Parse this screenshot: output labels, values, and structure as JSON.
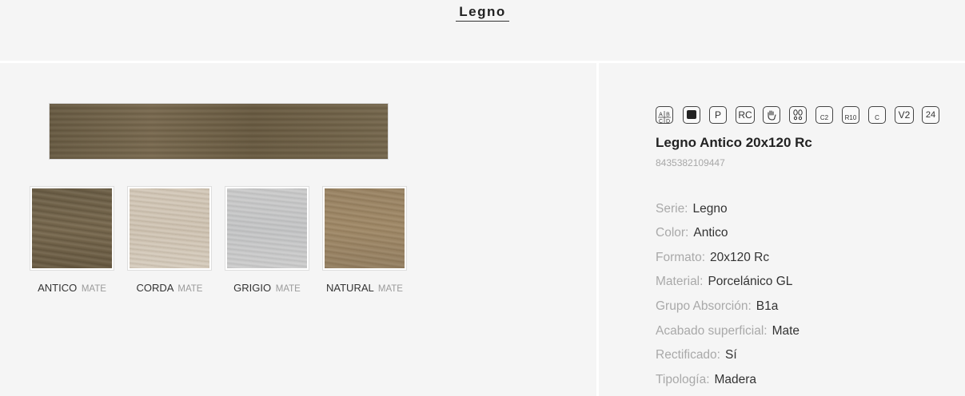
{
  "collection_title": "Legno",
  "product": {
    "name": "Legno Antico 20x120 Rc",
    "ean": "8435382109447"
  },
  "variants": [
    {
      "name": "ANTICO",
      "finish": "MATE"
    },
    {
      "name": "CORDA",
      "finish": "MATE"
    },
    {
      "name": "GRIGIO",
      "finish": "MATE"
    },
    {
      "name": "NATURAL",
      "finish": "MATE"
    }
  ],
  "feature_icons": [
    {
      "icon": "abcd-grade-icon",
      "text": "A B C D"
    },
    {
      "icon": "black-square-icon",
      "text": ""
    },
    {
      "icon": "p-icon",
      "text": "P"
    },
    {
      "icon": "rc-icon",
      "text": "RC"
    },
    {
      "icon": "hand-icon",
      "text": ""
    },
    {
      "icon": "footprints-icon",
      "text": ""
    },
    {
      "icon": "c2-icon",
      "text": "C2"
    },
    {
      "icon": "r10-icon",
      "text": "R10"
    },
    {
      "icon": "c-icon",
      "text": "C"
    },
    {
      "icon": "v2-icon",
      "text": "V2"
    },
    {
      "icon": "pieces-24-icon",
      "text": "24"
    }
  ],
  "specs": [
    {
      "key": "Serie:",
      "value": "Legno"
    },
    {
      "key": "Color:",
      "value": "Antico"
    },
    {
      "key": "Formato:",
      "value": "20x120 Rc"
    },
    {
      "key": "Material:",
      "value": "Porcelánico GL"
    },
    {
      "key": "Grupo Absorción:",
      "value": "B1a"
    },
    {
      "key": "Acabado superficial:",
      "value": "Mate"
    },
    {
      "key": "Rectificado:",
      "value": "Sí"
    },
    {
      "key": "Tipología:",
      "value": "Madera"
    }
  ],
  "colors": {
    "background": "#f5f5f5",
    "separator": "#ffffff",
    "label_muted": "#a9a9a9",
    "text": "#333333"
  }
}
